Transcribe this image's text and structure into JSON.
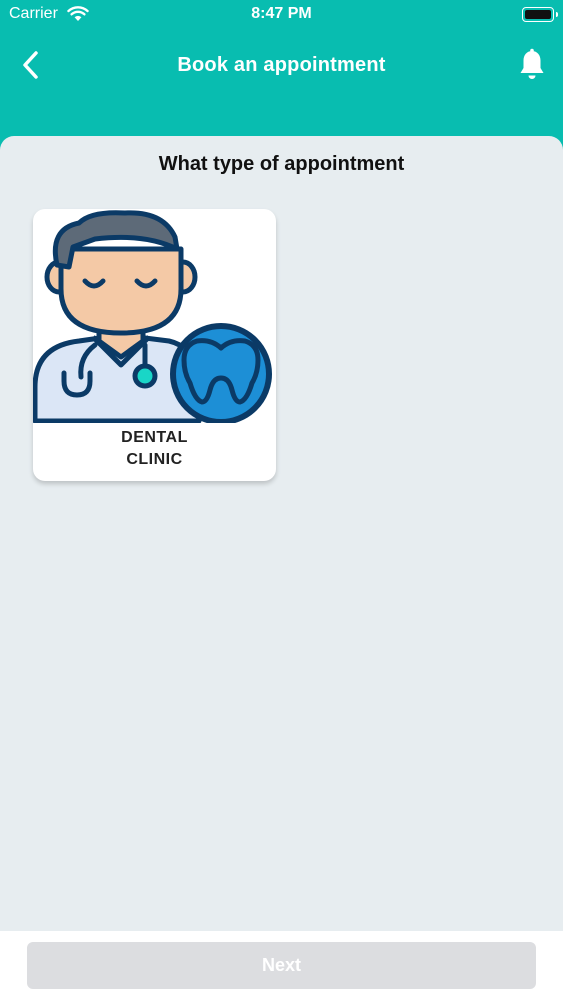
{
  "status_bar": {
    "carrier": "Carrier",
    "time": "8:47 PM"
  },
  "header": {
    "title": "Book an appointment",
    "back_icon": "chevron-left-icon",
    "notification_icon": "bell-icon"
  },
  "main": {
    "section_title": "What type of appointment",
    "options": [
      {
        "label": "DENTAL\nCLINIC",
        "icon": "dentist-doctor-icon"
      }
    ]
  },
  "footer": {
    "next_label": "Next"
  },
  "colors": {
    "accent": "#08bdb0",
    "background": "#e7edf0",
    "tooth_badge": "#1d8fd6",
    "disabled_button": "#dcdde0"
  }
}
